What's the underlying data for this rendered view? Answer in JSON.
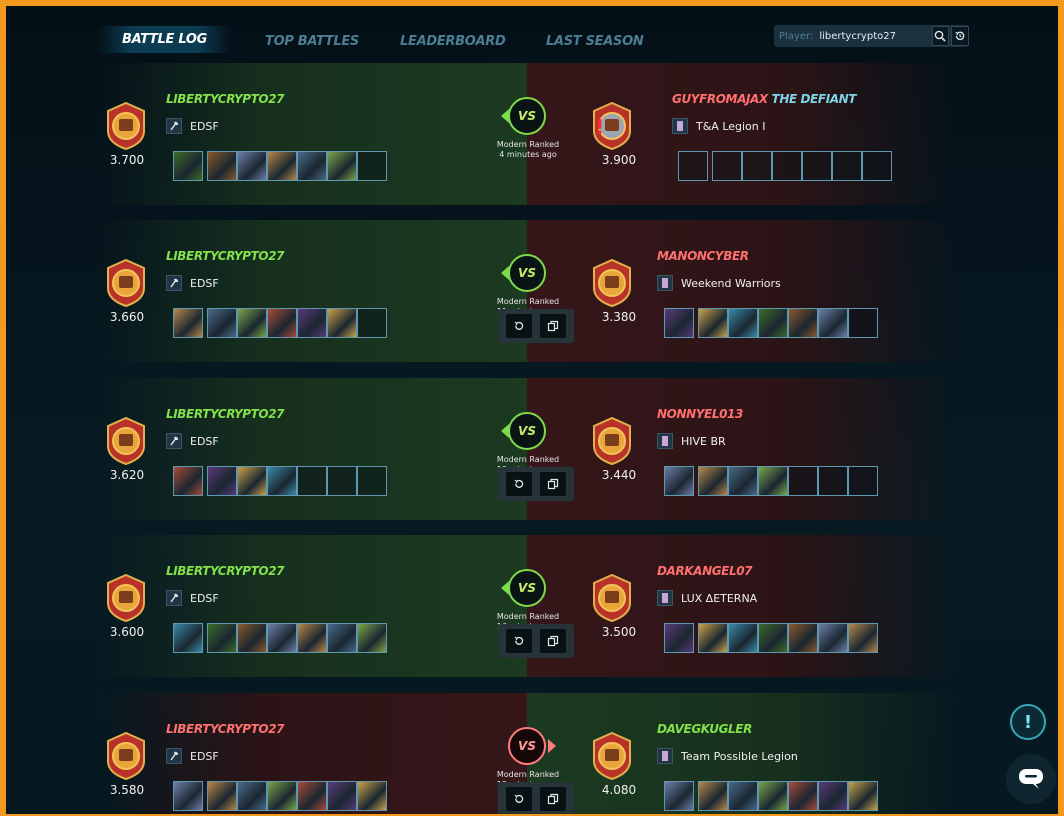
{
  "nav": {
    "tabs": [
      "BATTLE LOG",
      "TOP BATTLES",
      "LEADERBOARD",
      "LAST SEASON"
    ],
    "active_tab": "BATTLE LOG",
    "player_label": "Player:",
    "player_value": "libertycrypto27"
  },
  "battles": [
    {
      "left": {
        "name": "LIBERTYCRYPTO27",
        "result": "win",
        "guild": "EDSF",
        "rating": "3.700",
        "filled_cards": 6,
        "total_cards": 7
      },
      "right": {
        "name": "GUYFROMAJAX",
        "title": "THE DEFIANT",
        "result": "lose",
        "guild": "T&A Legion I",
        "rating": "3.900",
        "filled_cards": 0,
        "total_cards": 7,
        "alert": "!"
      },
      "vs": "VS",
      "mode": "Modern Ranked",
      "time": "4 minutes ago",
      "has_actions": false
    },
    {
      "left": {
        "name": "LIBERTYCRYPTO27",
        "result": "win",
        "guild": "EDSF",
        "rating": "3.660",
        "filled_cards": 6,
        "total_cards": 7
      },
      "right": {
        "name": "MANONCYBER",
        "result": "lose",
        "guild": "Weekend Warriors",
        "rating": "3.380",
        "filled_cards": 6,
        "total_cards": 7
      },
      "vs": "VS",
      "mode": "Modern Ranked",
      "time": "11 minutes ago",
      "has_actions": true
    },
    {
      "left": {
        "name": "LIBERTYCRYPTO27",
        "result": "win",
        "guild": "EDSF",
        "rating": "3.620",
        "filled_cards": 4,
        "total_cards": 7
      },
      "right": {
        "name": "NONNYEL013",
        "result": "lose",
        "guild": "HIVE BR",
        "rating": "3.440",
        "filled_cards": 4,
        "total_cards": 7
      },
      "vs": "VS",
      "mode": "Modern Ranked",
      "time": "13 minutes ago",
      "has_actions": true
    },
    {
      "left": {
        "name": "LIBERTYCRYPTO27",
        "result": "win",
        "guild": "EDSF",
        "rating": "3.600",
        "filled_cards": 7,
        "total_cards": 7
      },
      "right": {
        "name": "DARKANGEL07",
        "result": "lose",
        "guild": "LUX ΔETERNA",
        "rating": "3.500",
        "filled_cards": 7,
        "total_cards": 7
      },
      "vs": "VS",
      "mode": "Modern Ranked",
      "time": "16 minutes ago",
      "has_actions": true
    },
    {
      "left": {
        "name": "LIBERTYCRYPTO27",
        "result": "lose",
        "guild": "EDSF",
        "rating": "3.580",
        "filled_cards": 7,
        "total_cards": 7
      },
      "right": {
        "name": "DAVEGKUGLER",
        "result": "win",
        "guild": "Team Possible Legion",
        "rating": "4.080",
        "filled_cards": 7,
        "total_cards": 7
      },
      "vs": "VS",
      "mode": "Modern Ranked",
      "time": "18 minutes ago",
      "has_actions": true
    }
  ],
  "colors": {
    "win": "#82e04a",
    "lose": "#ff6f6f",
    "accent": "#f39a1e",
    "card_border": "#5f97b0"
  },
  "icons": {
    "search": "search-icon",
    "history": "history-icon",
    "replay": "replay-icon",
    "copy": "copy-icon",
    "help": "help-icon",
    "chat": "chat-icon"
  },
  "help_glyph": "!"
}
